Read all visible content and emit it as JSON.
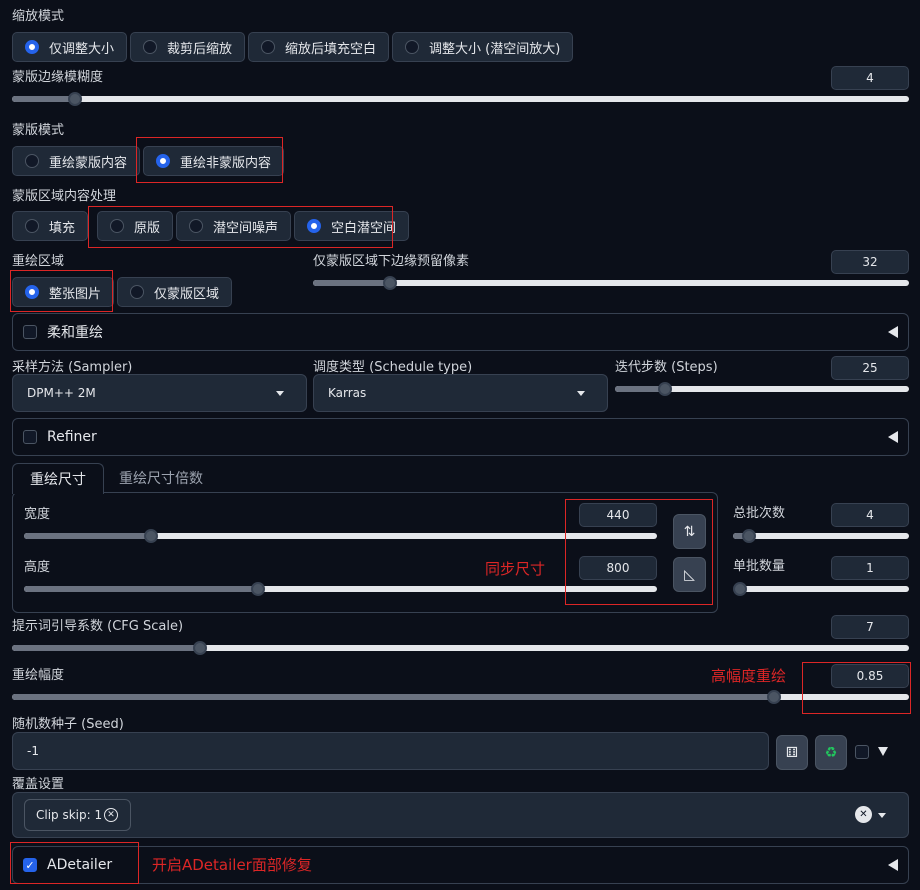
{
  "resize_mode": {
    "label": "缩放模式",
    "options": [
      "仅调整大小",
      "裁剪后缩放",
      "缩放后填充空白",
      "调整大小 (潜空间放大)"
    ],
    "selected": 0
  },
  "mask_blur": {
    "label": "蒙版边缘模糊度",
    "value": "4",
    "fraction": 0.07
  },
  "mask_mode": {
    "label": "蒙版模式",
    "options": [
      "重绘蒙版内容",
      "重绘非蒙版内容"
    ],
    "selected": 1
  },
  "masked_content": {
    "label": "蒙版区域内容处理",
    "options": [
      "填充",
      "原版",
      "潜空间噪声",
      "空白潜空间"
    ],
    "selected": 3
  },
  "inpaint_area": {
    "label": "重绘区域",
    "options": [
      "整张图片",
      "仅蒙版区域"
    ],
    "selected": 0
  },
  "only_masked_padding": {
    "label": "仅蒙版区域下边缘预留像素",
    "value": "32",
    "fraction": 0.13
  },
  "soft_inpaint": {
    "label": "柔和重绘",
    "checked": false
  },
  "sampler": {
    "label": "采样方法 (Sampler)",
    "value": "DPM++ 2M"
  },
  "schedule": {
    "label": "调度类型 (Schedule type)",
    "value": "Karras"
  },
  "steps": {
    "label": "迭代步数 (Steps)",
    "value": "25",
    "fraction": 0.17
  },
  "refiner": {
    "label": "Refiner",
    "checked": false
  },
  "size_tabs": {
    "tabs": [
      "重绘尺寸",
      "重绘尺寸倍数"
    ],
    "active": 0
  },
  "width": {
    "label": "宽度",
    "value": "440",
    "fraction": 0.2
  },
  "height": {
    "label": "高度",
    "value": "800",
    "fraction": 0.37
  },
  "batch_count": {
    "label": "总批次数",
    "value": "4",
    "fraction": 0.09
  },
  "batch_size": {
    "label": "单批数量",
    "value": "1",
    "fraction": 0.0
  },
  "cfg_scale": {
    "label": "提示词引导系数 (CFG Scale)",
    "value": "7",
    "fraction": 0.21
  },
  "denoise": {
    "label": "重绘幅度",
    "value": "0.85",
    "fraction": 0.85
  },
  "seed": {
    "label": "随机数种子 (Seed)",
    "value": "-1"
  },
  "override": {
    "label": "覆盖设置",
    "chip": "Clip skip: 1"
  },
  "adetailer": {
    "label": "ADetailer",
    "checked": true
  },
  "annotations": {
    "sync_size": "同步尺寸",
    "high_denoise": "高幅度重绘",
    "adetailer_note": "开启ADetailer面部修复"
  },
  "colors": {
    "accent": "#2563eb",
    "annotation": "#dc2626",
    "background": "#0b0f19"
  },
  "icons": [
    "swap-icon",
    "ruler-icon",
    "dice-icon",
    "recycle-icon",
    "close-icon",
    "chevron-down-icon",
    "triangle-left-icon"
  ]
}
